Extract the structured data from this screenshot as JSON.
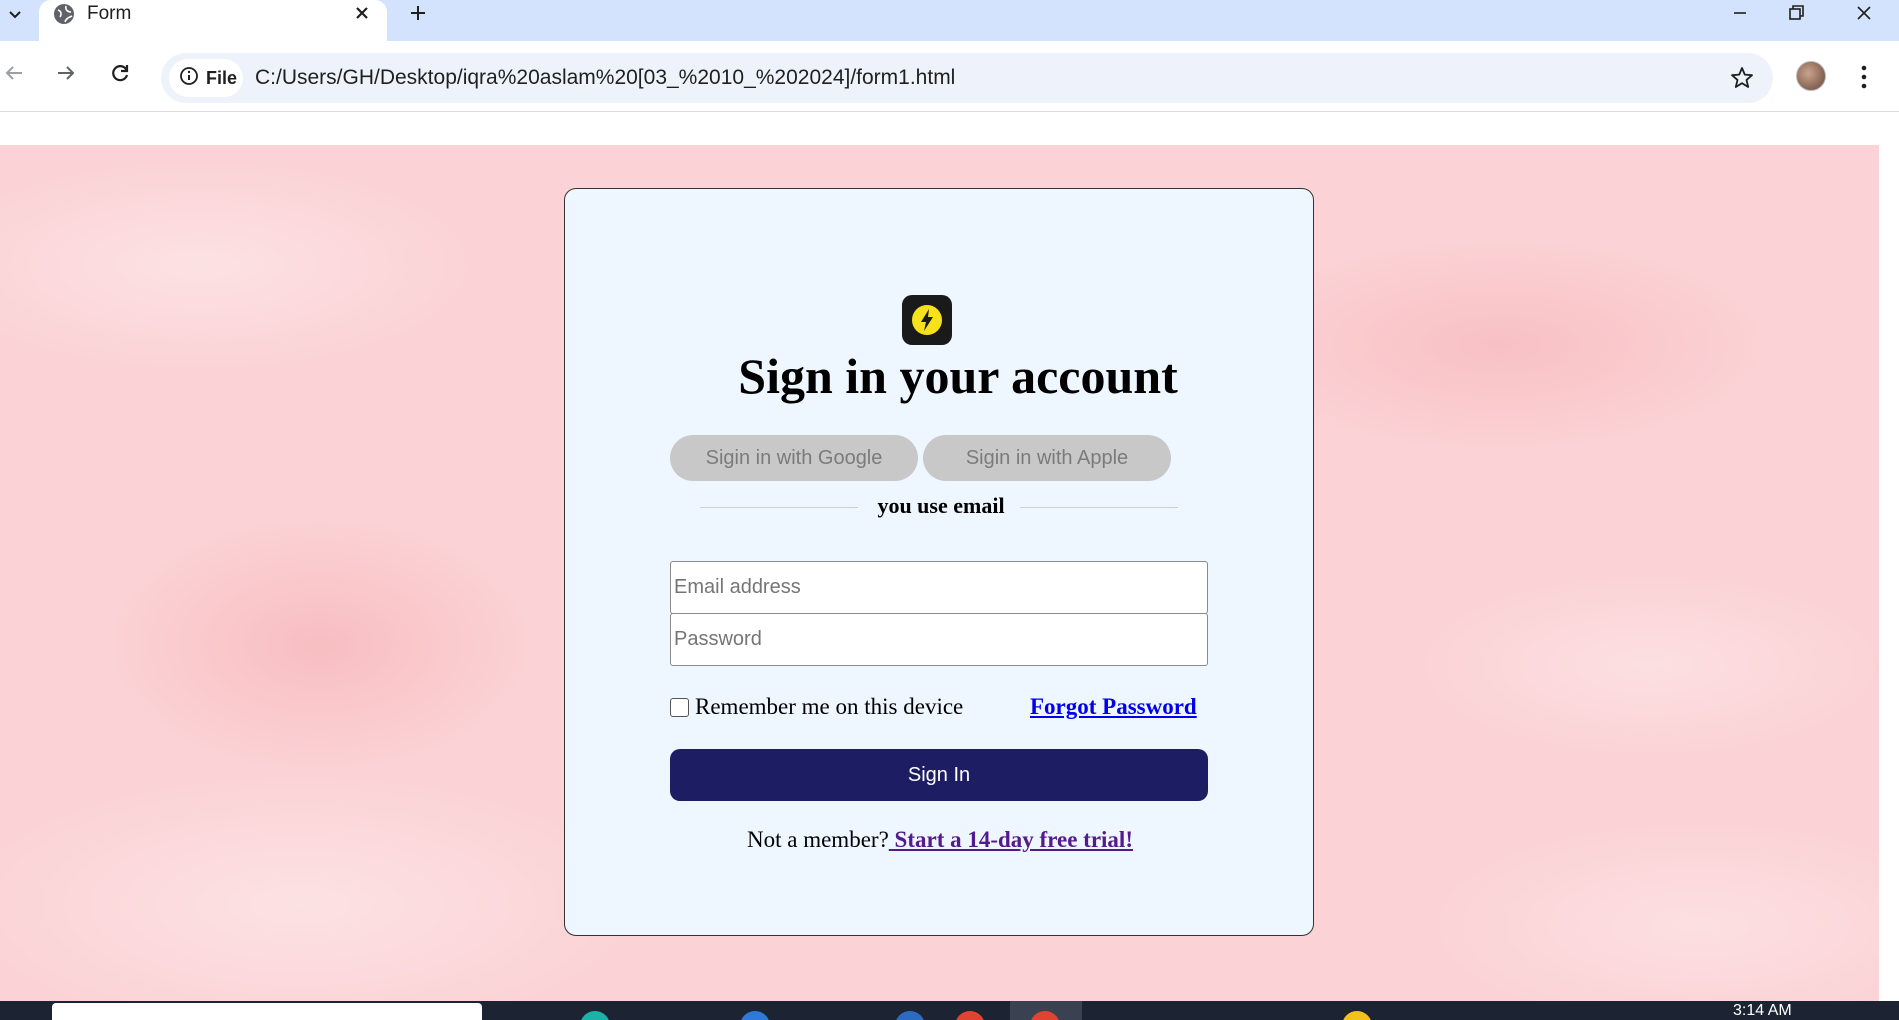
{
  "browser": {
    "tab_title": "Form",
    "site_chip": "File",
    "url": "C:/Users/GH/Desktop/iqra%20aslam%20[03_%2010_%202024]/form1.html"
  },
  "form": {
    "title": "Sign in your account",
    "google_button": "Sigin in with Google",
    "apple_button": "Sigin in with Apple",
    "divider_text": "you use email",
    "email_placeholder": "Email address",
    "password_placeholder": "Password",
    "remember_label": "Remember me on this device",
    "forgot_link": "Forgot Password",
    "signin_button": "Sign In",
    "not_member_text": "Not a member?",
    "trial_link": " Start a 14-day free trial!"
  },
  "taskbar": {
    "time": "3:14 AM"
  },
  "colors": {
    "page_background": "#fbd2d5",
    "card_background": "#eef6ff",
    "signin_button": "#1d1d63",
    "social_button": "#c8c8c8",
    "logo_accent": "#f7e11b"
  }
}
